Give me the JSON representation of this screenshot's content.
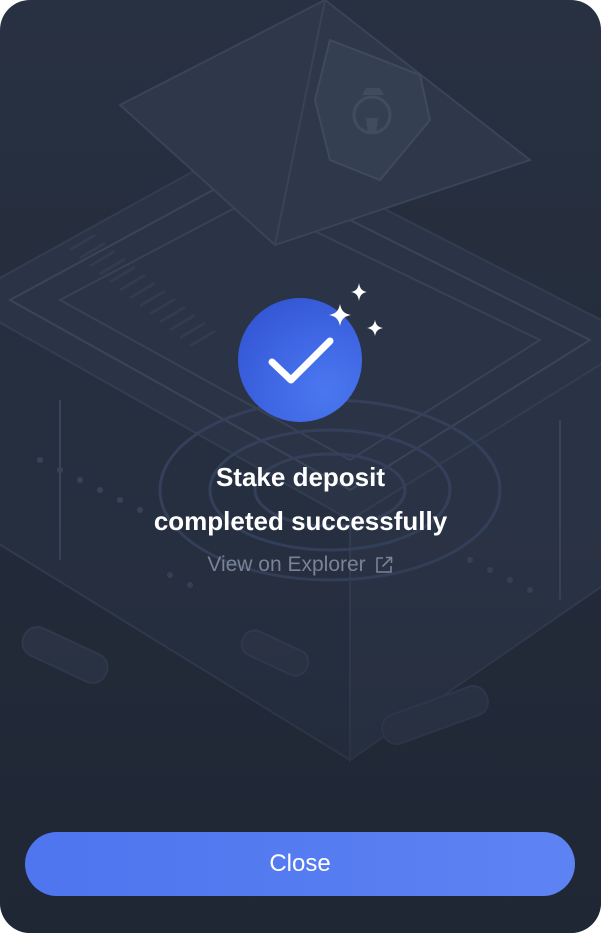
{
  "modal": {
    "title_line1": "Stake deposit",
    "title_line2": "completed successfully",
    "explorer_link": "View on Explorer",
    "close_label": "Close"
  },
  "icons": {
    "status": "checkmark-icon",
    "sparkles": "sparkle-icon",
    "external_link": "external-link-icon",
    "background_emblem": "spartan-helmet-shield-icon"
  },
  "colors": {
    "background": "#252d3c",
    "accent": "#4f75ef",
    "badge": "#3f66e4",
    "title_text": "#ffffff",
    "link_text": "#7a8396"
  }
}
